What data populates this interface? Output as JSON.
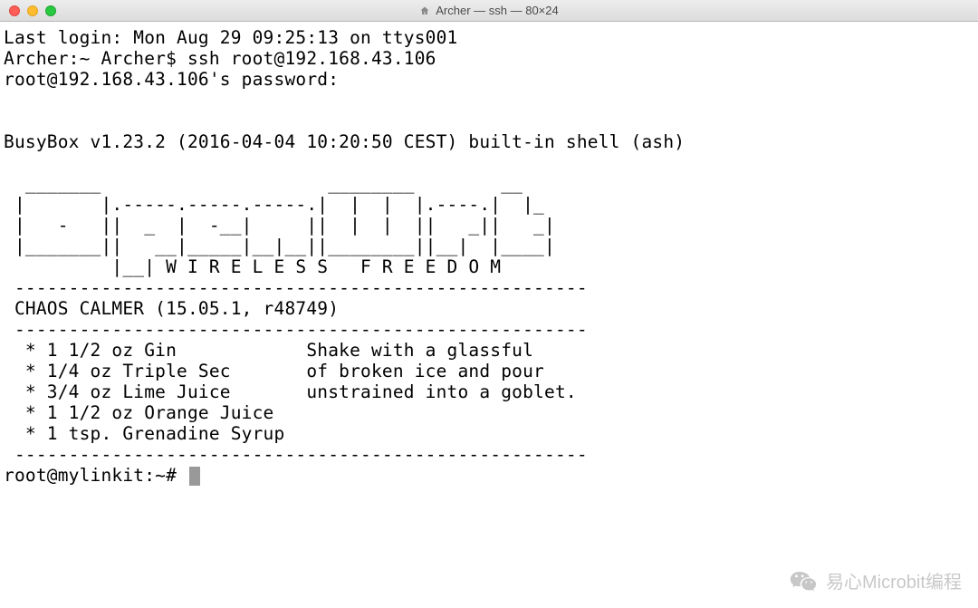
{
  "window": {
    "title": "Archer — ssh — 80×24"
  },
  "terminal": {
    "lines": [
      "Last login: Mon Aug 29 09:25:13 on ttys001",
      "Archer:~ Archer$ ssh root@192.168.43.106",
      "root@192.168.43.106's password:",
      "",
      "",
      "BusyBox v1.23.2 (2016-04-04 10:20:50 CEST) built-in shell (ash)",
      "",
      "  _______                     ________        __",
      " |       |.-----.-----.-----.|  |  |  |.----.|  |_",
      " |   -   ||  _  |  -__|     ||  |  |  ||   _||   _|",
      " |_______||   __|_____|__|__||________||__|  |____|",
      "          |__| W I R E L E S S   F R E E D O M",
      " -----------------------------------------------------",
      " CHAOS CALMER (15.05.1, r48749)",
      " -----------------------------------------------------",
      "  * 1 1/2 oz Gin            Shake with a glassful",
      "  * 1/4 oz Triple Sec       of broken ice and pour",
      "  * 3/4 oz Lime Juice       unstrained into a goblet.",
      "  * 1 1/2 oz Orange Juice",
      "  * 1 tsp. Grenadine Syrup",
      " -----------------------------------------------------"
    ],
    "prompt": "root@mylinkit:~# "
  },
  "watermark": {
    "text": "易心Microbit编程"
  }
}
